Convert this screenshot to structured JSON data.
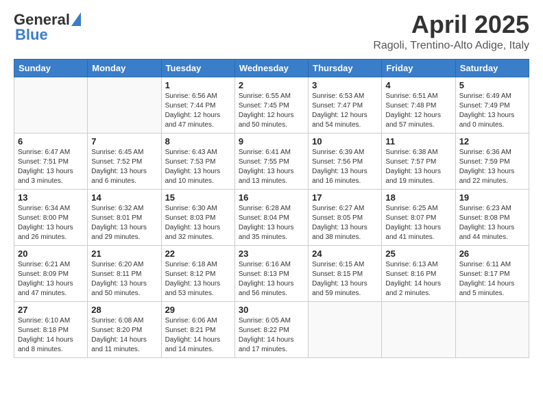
{
  "header": {
    "logo": {
      "general": "General",
      "blue": "Blue"
    },
    "title": "April 2025",
    "location": "Ragoli, Trentino-Alto Adige, Italy"
  },
  "weekdays": [
    "Sunday",
    "Monday",
    "Tuesday",
    "Wednesday",
    "Thursday",
    "Friday",
    "Saturday"
  ],
  "weeks": [
    [
      {
        "day": "",
        "info": ""
      },
      {
        "day": "",
        "info": ""
      },
      {
        "day": "1",
        "info": "Sunrise: 6:56 AM\nSunset: 7:44 PM\nDaylight: 12 hours and 47 minutes."
      },
      {
        "day": "2",
        "info": "Sunrise: 6:55 AM\nSunset: 7:45 PM\nDaylight: 12 hours and 50 minutes."
      },
      {
        "day": "3",
        "info": "Sunrise: 6:53 AM\nSunset: 7:47 PM\nDaylight: 12 hours and 54 minutes."
      },
      {
        "day": "4",
        "info": "Sunrise: 6:51 AM\nSunset: 7:48 PM\nDaylight: 12 hours and 57 minutes."
      },
      {
        "day": "5",
        "info": "Sunrise: 6:49 AM\nSunset: 7:49 PM\nDaylight: 13 hours and 0 minutes."
      }
    ],
    [
      {
        "day": "6",
        "info": "Sunrise: 6:47 AM\nSunset: 7:51 PM\nDaylight: 13 hours and 3 minutes."
      },
      {
        "day": "7",
        "info": "Sunrise: 6:45 AM\nSunset: 7:52 PM\nDaylight: 13 hours and 6 minutes."
      },
      {
        "day": "8",
        "info": "Sunrise: 6:43 AM\nSunset: 7:53 PM\nDaylight: 13 hours and 10 minutes."
      },
      {
        "day": "9",
        "info": "Sunrise: 6:41 AM\nSunset: 7:55 PM\nDaylight: 13 hours and 13 minutes."
      },
      {
        "day": "10",
        "info": "Sunrise: 6:39 AM\nSunset: 7:56 PM\nDaylight: 13 hours and 16 minutes."
      },
      {
        "day": "11",
        "info": "Sunrise: 6:38 AM\nSunset: 7:57 PM\nDaylight: 13 hours and 19 minutes."
      },
      {
        "day": "12",
        "info": "Sunrise: 6:36 AM\nSunset: 7:59 PM\nDaylight: 13 hours and 22 minutes."
      }
    ],
    [
      {
        "day": "13",
        "info": "Sunrise: 6:34 AM\nSunset: 8:00 PM\nDaylight: 13 hours and 26 minutes."
      },
      {
        "day": "14",
        "info": "Sunrise: 6:32 AM\nSunset: 8:01 PM\nDaylight: 13 hours and 29 minutes."
      },
      {
        "day": "15",
        "info": "Sunrise: 6:30 AM\nSunset: 8:03 PM\nDaylight: 13 hours and 32 minutes."
      },
      {
        "day": "16",
        "info": "Sunrise: 6:28 AM\nSunset: 8:04 PM\nDaylight: 13 hours and 35 minutes."
      },
      {
        "day": "17",
        "info": "Sunrise: 6:27 AM\nSunset: 8:05 PM\nDaylight: 13 hours and 38 minutes."
      },
      {
        "day": "18",
        "info": "Sunrise: 6:25 AM\nSunset: 8:07 PM\nDaylight: 13 hours and 41 minutes."
      },
      {
        "day": "19",
        "info": "Sunrise: 6:23 AM\nSunset: 8:08 PM\nDaylight: 13 hours and 44 minutes."
      }
    ],
    [
      {
        "day": "20",
        "info": "Sunrise: 6:21 AM\nSunset: 8:09 PM\nDaylight: 13 hours and 47 minutes."
      },
      {
        "day": "21",
        "info": "Sunrise: 6:20 AM\nSunset: 8:11 PM\nDaylight: 13 hours and 50 minutes."
      },
      {
        "day": "22",
        "info": "Sunrise: 6:18 AM\nSunset: 8:12 PM\nDaylight: 13 hours and 53 minutes."
      },
      {
        "day": "23",
        "info": "Sunrise: 6:16 AM\nSunset: 8:13 PM\nDaylight: 13 hours and 56 minutes."
      },
      {
        "day": "24",
        "info": "Sunrise: 6:15 AM\nSunset: 8:15 PM\nDaylight: 13 hours and 59 minutes."
      },
      {
        "day": "25",
        "info": "Sunrise: 6:13 AM\nSunset: 8:16 PM\nDaylight: 14 hours and 2 minutes."
      },
      {
        "day": "26",
        "info": "Sunrise: 6:11 AM\nSunset: 8:17 PM\nDaylight: 14 hours and 5 minutes."
      }
    ],
    [
      {
        "day": "27",
        "info": "Sunrise: 6:10 AM\nSunset: 8:18 PM\nDaylight: 14 hours and 8 minutes."
      },
      {
        "day": "28",
        "info": "Sunrise: 6:08 AM\nSunset: 8:20 PM\nDaylight: 14 hours and 11 minutes."
      },
      {
        "day": "29",
        "info": "Sunrise: 6:06 AM\nSunset: 8:21 PM\nDaylight: 14 hours and 14 minutes."
      },
      {
        "day": "30",
        "info": "Sunrise: 6:05 AM\nSunset: 8:22 PM\nDaylight: 14 hours and 17 minutes."
      },
      {
        "day": "",
        "info": ""
      },
      {
        "day": "",
        "info": ""
      },
      {
        "day": "",
        "info": ""
      }
    ]
  ]
}
